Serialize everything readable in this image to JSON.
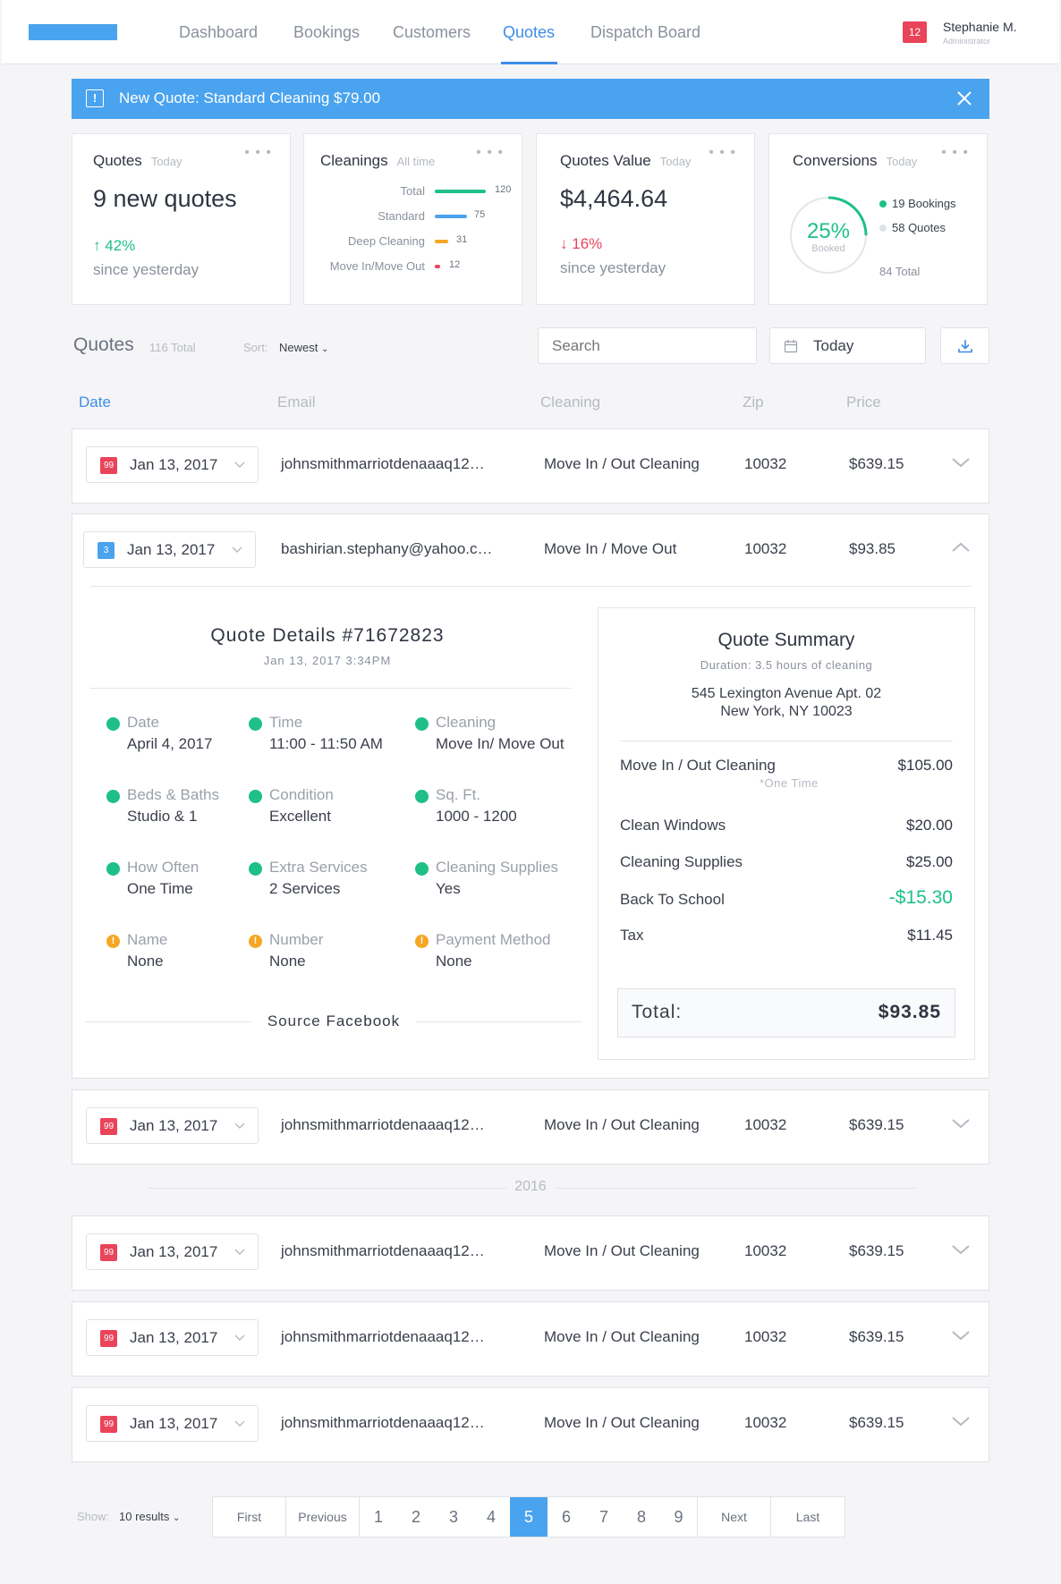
{
  "nav": {
    "items": [
      "Dashboard",
      "Bookings",
      "Customers",
      "Quotes",
      "Dispatch Board"
    ],
    "active": "Quotes",
    "notifications": "12",
    "user_name": "Stephanie M.",
    "user_role": "Administrator"
  },
  "alert": {
    "text": "New Quote: Standard Cleaning $79.00",
    "icon": "!"
  },
  "cards": {
    "quotes": {
      "title": "Quotes",
      "period": "Today",
      "value": "9 new quotes",
      "delta": "42%",
      "since": "since yesterday"
    },
    "cleanings": {
      "title": "Cleanings",
      "period": "All time",
      "rows": [
        {
          "label": "Total",
          "value": "120",
          "color": "#1ec087"
        },
        {
          "label": "Standard",
          "value": "75",
          "color": "#4aa3ee"
        },
        {
          "label": "Deep Cleaning",
          "value": "31",
          "color": "#f5a623"
        },
        {
          "label": "Move In/Move Out",
          "value": "12",
          "color": "#e9445a"
        }
      ]
    },
    "value": {
      "title": "Quotes Value",
      "period": "Today",
      "value": "$4,464.64",
      "delta": "16%",
      "since": "since yesterday"
    },
    "conversions": {
      "title": "Conversions",
      "period": "Today",
      "percent": "25%",
      "percent_label": "Booked",
      "fraction": 0.25,
      "bookings": "19 Bookings",
      "quotes": "58 Quotes",
      "total": "84 Total"
    }
  },
  "list": {
    "title": "Quotes",
    "count": "116 Total",
    "sort_label": "Sort:",
    "sort_value": "Newest",
    "search_placeholder": "Search",
    "date_filter": "Today"
  },
  "columns": [
    "Date",
    "Email",
    "Cleaning",
    "Zip",
    "Price"
  ],
  "rows_top": [
    {
      "badge": "99",
      "date": "Jan 13, 2017",
      "email": "johnsmithmarriotdenaaaq12…",
      "cleaning": "Move In / Out Cleaning",
      "zip": "10032",
      "price": "$639.15"
    }
  ],
  "expanded": {
    "badge": "3",
    "date": "Jan 13, 2017",
    "email": "bashirian.stephany@yahoo.c…",
    "cleaning": "Move In / Move Out",
    "zip": "10032",
    "price": "$93.85",
    "details_title": "Quote Details #71672823",
    "details_date": "Jan 13, 2017 3:34PM",
    "details": [
      {
        "label": "Date",
        "value": "April 4, 2017",
        "status": "ok"
      },
      {
        "label": "Time",
        "value": "11:00 - 11:50 AM",
        "status": "ok"
      },
      {
        "label": "Cleaning",
        "value": "Move In/ Move Out",
        "status": "ok"
      },
      {
        "label": "Beds & Baths",
        "value": "Studio & 1",
        "status": "ok"
      },
      {
        "label": "Condition",
        "value": "Excellent",
        "status": "ok"
      },
      {
        "label": "Sq. Ft.",
        "value": "1000 - 1200",
        "status": "ok"
      },
      {
        "label": "How Often",
        "value": "One Time",
        "status": "ok"
      },
      {
        "label": "Extra Services",
        "value": "2 Services",
        "status": "ok"
      },
      {
        "label": "Cleaning Supplies",
        "value": "Yes",
        "status": "ok"
      },
      {
        "label": "Name",
        "value": "None",
        "status": "warn"
      },
      {
        "label": "Number",
        "value": "None",
        "status": "warn"
      },
      {
        "label": "Payment Method",
        "value": "None",
        "status": "warn"
      }
    ],
    "source_label": "Source",
    "source_value": "Facebook",
    "summary": {
      "title": "Quote Summary",
      "duration": "Duration: 3.5 hours of cleaning",
      "address_line1": "545 Lexington Avenue Apt. 02",
      "address_line2": "New York, NY 10023",
      "lines": [
        {
          "label": "Move In / Out Cleaning",
          "amount": "$105.00"
        },
        {
          "label": "Clean Windows",
          "amount": "$20.00"
        },
        {
          "label": "Cleaning Supplies",
          "amount": "$25.00"
        },
        {
          "label": "Back To School",
          "amount": "-$15.30"
        },
        {
          "label": "Tax",
          "amount": "$11.45"
        }
      ],
      "one_time": "*One Time",
      "total_label": "Total:",
      "total_value": "$93.85"
    }
  },
  "rows_mid": [
    {
      "badge": "99",
      "date": "Jan 13, 2017",
      "email": "johnsmithmarriotdenaaaq12…",
      "cleaning": "Move In / Out Cleaning",
      "zip": "10032",
      "price": "$639.15"
    }
  ],
  "year_separator": "2016",
  "rows_bottom": [
    {
      "badge": "99",
      "date": "Jan 13, 2017",
      "email": "johnsmithmarriotdenaaaq12…",
      "cleaning": "Move In / Out Cleaning",
      "zip": "10032",
      "price": "$639.15"
    },
    {
      "badge": "99",
      "date": "Jan 13, 2017",
      "email": "johnsmithmarriotdenaaaq12…",
      "cleaning": "Move In / Out Cleaning",
      "zip": "10032",
      "price": "$639.15"
    },
    {
      "badge": "99",
      "date": "Jan 13, 2017",
      "email": "johnsmithmarriotdenaaaq12…",
      "cleaning": "Move In / Out Cleaning",
      "zip": "10032",
      "price": "$639.15"
    }
  ],
  "pagination": {
    "show_label": "Show:",
    "show_value": "10 results",
    "first": "First",
    "previous": "Previous",
    "next": "Next",
    "last": "Last",
    "pages": [
      "1",
      "2",
      "3",
      "4",
      "5",
      "6",
      "7",
      "8",
      "9"
    ],
    "current": "5"
  }
}
